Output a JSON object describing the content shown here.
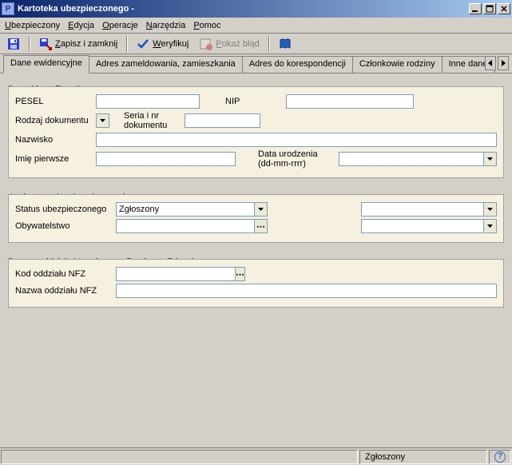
{
  "window": {
    "title": "Kartoteka ubezpieczonego  -",
    "app_icon_letter": "P"
  },
  "menu": {
    "items": [
      {
        "full": "Ubezpieczony",
        "u": "U",
        "rest": "bezpieczony"
      },
      {
        "full": "Edycja",
        "u": "E",
        "rest": "dycja"
      },
      {
        "full": "Operacje",
        "u": "O",
        "rest": "peracje"
      },
      {
        "full": "Narzędzia",
        "u": "N",
        "rest": "arzędzia"
      },
      {
        "full": "Pomoc",
        "u": "P",
        "rest": "omoc"
      }
    ]
  },
  "toolbar": {
    "save_icon": "floppy",
    "save_close": {
      "u": "Z",
      "before": "",
      "after": "apisz i zamknij"
    },
    "verify": {
      "u": "W",
      "before": "",
      "after": "eryfikuj"
    },
    "show_error": {
      "u": "P",
      "before": "",
      "after": "okaż błąd"
    },
    "help_icon": "book"
  },
  "tabs": {
    "items": [
      "Dane ewidencyjne",
      "Adres zameldowania, zamieszkania",
      "Adres do korespondencji",
      "Członkowie rodziny",
      "Inne dane"
    ],
    "active_index": 0
  },
  "section1": {
    "legend": "Dane identyfikacyjne",
    "pesel_label": "PESEL",
    "pesel_value": "",
    "nip_label": "NIP",
    "nip_value": "",
    "rodzaj_label": "Rodzaj dokumentu",
    "rodzaj_value": "",
    "seria_label": "Seria i nr dokumentu",
    "seria_value": "",
    "nazwisko_label": "Nazwisko",
    "nazwisko_value": "",
    "imie_label": "Imię pierwsze",
    "imie_value": "",
    "data_label": "Data urodzenia (dd-mm-rrrr)",
    "data_value": ""
  },
  "section2": {
    "legend": "Atrybuty osoby ubezpieczonej",
    "status_label": "Status ubezpieczonego",
    "status_value": "Zgłoszony",
    "status2_value": "",
    "obyw_label": "Obywatelstwo",
    "obyw_value": "",
    "obyw2_value": ""
  },
  "section3": {
    "legend": "Dane o oddziale Narodowego Funduszu Zdrowia",
    "kod_label": "Kod oddziału NFZ",
    "kod_value": "",
    "nazwa_label": "Nazwa oddziału NFZ",
    "nazwa_value": ""
  },
  "status": {
    "main": "",
    "text": "Zgłoszony",
    "help": "?"
  }
}
